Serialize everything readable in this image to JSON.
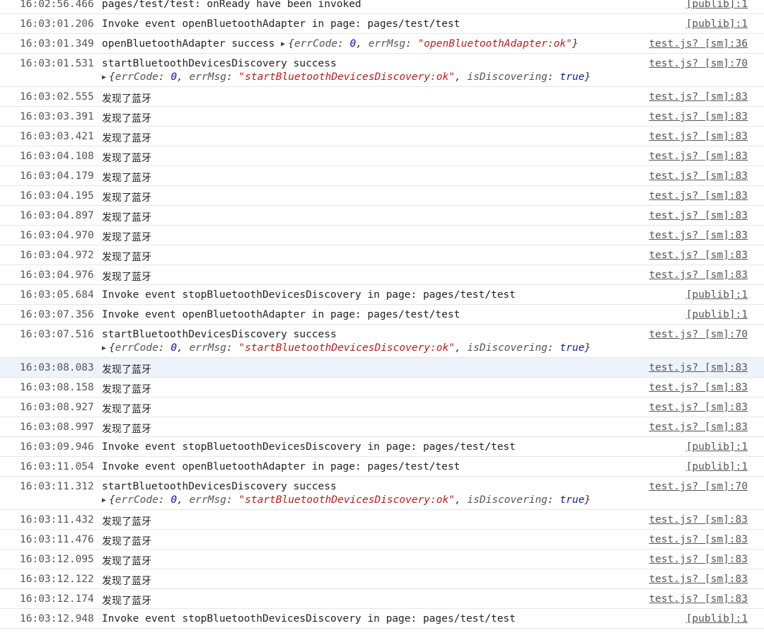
{
  "rows": [
    {
      "ts": "16:02:56.466",
      "kind": "text",
      "text": "pages/test/test: onReady have been invoked",
      "src": "[publib]:1"
    },
    {
      "ts": "16:03:01.206",
      "kind": "text",
      "text": "Invoke event openBluetoothAdapter in page: pages/test/test",
      "src": "[publib]:1"
    },
    {
      "ts": "16:03:01.349",
      "kind": "inline-obj",
      "text": "openBluetoothAdapter success ",
      "obj": {
        "k1": "errCode",
        "v1": "0",
        "k2": "errMsg",
        "v2": "\"openBluetoothAdapter:ok\""
      },
      "src": "test.js? [sm]:36"
    },
    {
      "ts": "16:03:01.531",
      "kind": "double-obj",
      "text": "startBluetoothDevicesDiscovery success",
      "obj": {
        "k1": "errCode",
        "v1": "0",
        "k2": "errMsg",
        "v2": "\"startBluetoothDevicesDiscovery:ok\"",
        "k3": "isDiscovering",
        "v3": "true"
      },
      "src": "test.js? [sm]:70"
    },
    {
      "ts": "16:03:02.555",
      "kind": "cn",
      "text": "发现了蓝牙",
      "src": "test.js? [sm]:83"
    },
    {
      "ts": "16:03:03.391",
      "kind": "cn",
      "text": "发现了蓝牙",
      "src": "test.js? [sm]:83"
    },
    {
      "ts": "16:03:03.421",
      "kind": "cn",
      "text": "发现了蓝牙",
      "src": "test.js? [sm]:83"
    },
    {
      "ts": "16:03:04.108",
      "kind": "cn",
      "text": "发现了蓝牙",
      "src": "test.js? [sm]:83"
    },
    {
      "ts": "16:03:04.179",
      "kind": "cn",
      "text": "发现了蓝牙",
      "src": "test.js? [sm]:83"
    },
    {
      "ts": "16:03:04.195",
      "kind": "cn",
      "text": "发现了蓝牙",
      "src": "test.js? [sm]:83"
    },
    {
      "ts": "16:03:04.897",
      "kind": "cn",
      "text": "发现了蓝牙",
      "src": "test.js? [sm]:83"
    },
    {
      "ts": "16:03:04.970",
      "kind": "cn",
      "text": "发现了蓝牙",
      "src": "test.js? [sm]:83"
    },
    {
      "ts": "16:03:04.972",
      "kind": "cn",
      "text": "发现了蓝牙",
      "src": "test.js? [sm]:83"
    },
    {
      "ts": "16:03:04.976",
      "kind": "cn",
      "text": "发现了蓝牙",
      "src": "test.js? [sm]:83"
    },
    {
      "ts": "16:03:05.684",
      "kind": "text",
      "text": "Invoke event stopBluetoothDevicesDiscovery in page: pages/test/test",
      "src": "[publib]:1"
    },
    {
      "ts": "16:03:07.356",
      "kind": "text",
      "text": "Invoke event openBluetoothAdapter in page: pages/test/test",
      "src": "[publib]:1"
    },
    {
      "ts": "16:03:07.516",
      "kind": "double-obj",
      "text": "startBluetoothDevicesDiscovery success",
      "obj": {
        "k1": "errCode",
        "v1": "0",
        "k2": "errMsg",
        "v2": "\"startBluetoothDevicesDiscovery:ok\"",
        "k3": "isDiscovering",
        "v3": "true"
      },
      "src": "test.js? [sm]:70"
    },
    {
      "ts": "16:03:08.083",
      "kind": "cn",
      "text": "发现了蓝牙",
      "src": "test.js? [sm]:83",
      "selected": true
    },
    {
      "ts": "16:03:08.158",
      "kind": "cn",
      "text": "发现了蓝牙",
      "src": "test.js? [sm]:83"
    },
    {
      "ts": "16:03:08.927",
      "kind": "cn",
      "text": "发现了蓝牙",
      "src": "test.js? [sm]:83"
    },
    {
      "ts": "16:03:08.997",
      "kind": "cn",
      "text": "发现了蓝牙",
      "src": "test.js? [sm]:83"
    },
    {
      "ts": "16:03:09.946",
      "kind": "text",
      "text": "Invoke event stopBluetoothDevicesDiscovery in page: pages/test/test",
      "src": "[publib]:1"
    },
    {
      "ts": "16:03:11.054",
      "kind": "text",
      "text": "Invoke event openBluetoothAdapter in page: pages/test/test",
      "src": "[publib]:1"
    },
    {
      "ts": "16:03:11.312",
      "kind": "double-obj",
      "text": "startBluetoothDevicesDiscovery success",
      "obj": {
        "k1": "errCode",
        "v1": "0",
        "k2": "errMsg",
        "v2": "\"startBluetoothDevicesDiscovery:ok\"",
        "k3": "isDiscovering",
        "v3": "true"
      },
      "src": "test.js? [sm]:70"
    },
    {
      "ts": "16:03:11.432",
      "kind": "cn",
      "text": "发现了蓝牙",
      "src": "test.js? [sm]:83"
    },
    {
      "ts": "16:03:11.476",
      "kind": "cn",
      "text": "发现了蓝牙",
      "src": "test.js? [sm]:83"
    },
    {
      "ts": "16:03:12.095",
      "kind": "cn",
      "text": "发现了蓝牙",
      "src": "test.js? [sm]:83"
    },
    {
      "ts": "16:03:12.122",
      "kind": "cn",
      "text": "发现了蓝牙",
      "src": "test.js? [sm]:83"
    },
    {
      "ts": "16:03:12.174",
      "kind": "cn",
      "text": "发现了蓝牙",
      "src": "test.js? [sm]:83"
    },
    {
      "ts": "16:03:12.948",
      "kind": "text",
      "text": "Invoke event stopBluetoothDevicesDiscovery in page: pages/test/test",
      "src": "[publib]:1"
    }
  ],
  "icons": {
    "expand_triangle": "▶"
  }
}
